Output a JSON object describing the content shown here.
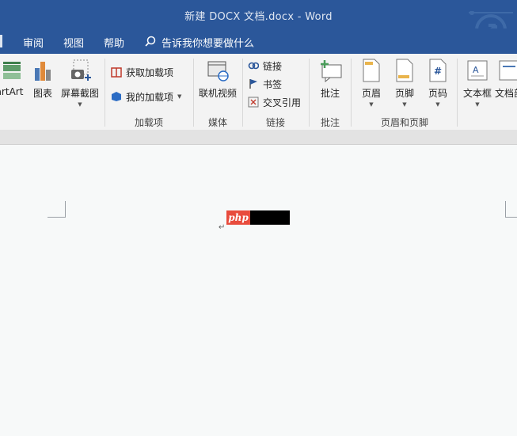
{
  "window": {
    "title": "新建 DOCX 文档.docx  -  Word"
  },
  "menu": {
    "review": "审阅",
    "view": "视图",
    "help": "帮助",
    "tell_me": "告诉我你想要做什么"
  },
  "ribbon": {
    "smartart": "artArt",
    "chart": "图表",
    "screenshot": "屏幕截图",
    "get_addins": "获取加载项",
    "my_addins": "我的加载项",
    "online_video": "联机视频",
    "link": "链接",
    "bookmark": "书签",
    "cross_ref": "交叉引用",
    "comment": "批注",
    "header": "页眉",
    "footer": "页脚",
    "page_number": "页码",
    "textbox": "文本框",
    "docpart": "文档部",
    "groups": {
      "addins": "加载项",
      "media": "媒体",
      "links": "链接",
      "comments": "批注",
      "header_footer": "页眉和页脚"
    }
  },
  "document": {
    "watermark_text": "php"
  },
  "colors": {
    "accent": "#2b579a",
    "ribbon_bg": "#f3f3f3",
    "doc_bg": "#f7f9f9",
    "watermark_red": "#e84c3d"
  }
}
